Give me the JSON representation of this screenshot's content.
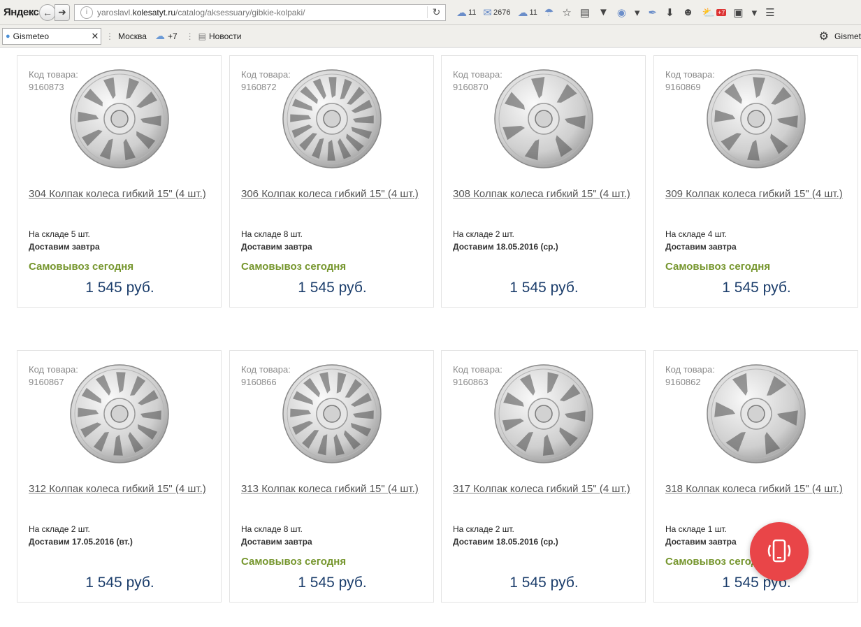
{
  "browser": {
    "brand": "Яндекс",
    "url_prefix": "yaroslavl.",
    "url_domain": "kolesatyt.ru",
    "url_path": "/catalog/aksessuary/gibkie-kolpaki/",
    "toolbar": {
      "cloud_count": "11",
      "mail_count": "2676",
      "disk_count": "11",
      "weather_badge": "+7"
    }
  },
  "bookmarks": {
    "tab_title": "Gismeteo",
    "city": "Москва",
    "temp": "+7",
    "news": "Новости",
    "right_label": "Gismet"
  },
  "labels": {
    "code": "Код товара:",
    "pickup": "Самовывоз сегодня"
  },
  "products": [
    {
      "code": "9160873",
      "title": "304 Колпак колеса гибкий 15\" (4 шт.)",
      "stock": "На складе 5 шт.",
      "delivery": "Доставим завтра",
      "pickup": true,
      "price": "1 545 руб.",
      "spokes": 10
    },
    {
      "code": "9160872",
      "title": "306 Колпак колеса гибкий 15\" (4 шт.)",
      "stock": "На складе 8 шт.",
      "delivery": "Доставим завтра",
      "pickup": true,
      "price": "1 545 руб.",
      "spokes": 16
    },
    {
      "code": "9160870",
      "title": "308 Колпак колеса гибкий 15\" (4 шт.)",
      "stock": "На складе 2 шт.",
      "delivery": "Доставим 18.05.2016 (ср.)",
      "pickup": false,
      "price": "1 545 руб.",
      "spokes": 7
    },
    {
      "code": "9160869",
      "title": "309 Колпак колеса гибкий 15\" (4 шт.)",
      "stock": "На складе 4 шт.",
      "delivery": "Доставим завтра",
      "pickup": true,
      "price": "1 545 руб.",
      "spokes": 8
    },
    {
      "code": "9160867",
      "title": "312 Колпак колеса гибкий 15\" (4 шт.)",
      "stock": "На складе 2 шт.",
      "delivery": "Доставим 17.05.2016 (вт.)",
      "pickup": false,
      "price": "1 545 руб.",
      "spokes": 12
    },
    {
      "code": "9160866",
      "title": "313 Колпак колеса гибкий 15\" (4 шт.)",
      "stock": "На складе 8 шт.",
      "delivery": "Доставим завтра",
      "pickup": true,
      "price": "1 545 руб.",
      "spokes": 14
    },
    {
      "code": "9160863",
      "title": "317 Колпак колеса гибкий 15\" (4 шт.)",
      "stock": "На складе 2 шт.",
      "delivery": "Доставим 18.05.2016 (ср.)",
      "pickup": false,
      "price": "1 545 руб.",
      "spokes": 9
    },
    {
      "code": "9160862",
      "title": "318 Колпак колеса гибкий 15\" (4 шт.)",
      "stock": "На складе 1 шт.",
      "delivery": "Доставим завтра",
      "pickup": true,
      "price": "1 545 руб.",
      "spokes": 6
    }
  ],
  "colors": {
    "price": "#1b3d6b",
    "pickup": "#76962e",
    "call_button": "#e94548"
  }
}
